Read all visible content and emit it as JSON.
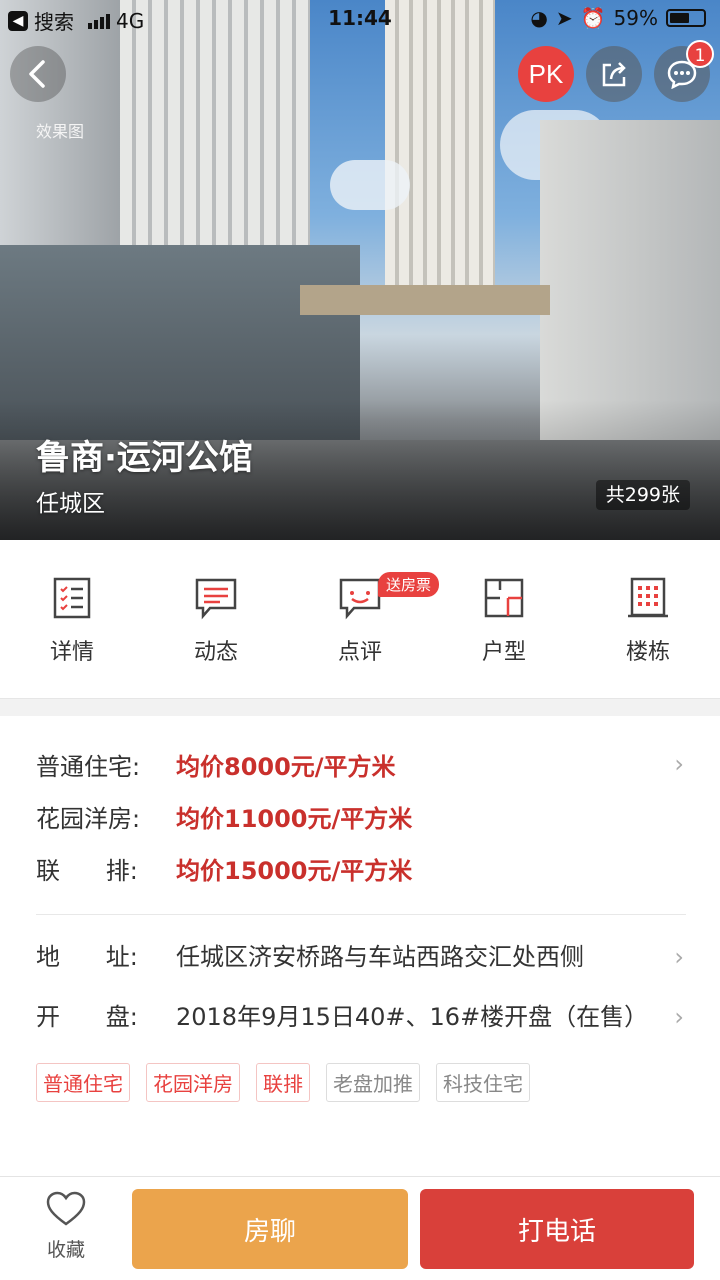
{
  "status_bar": {
    "carrier": "搜索",
    "network": "4G",
    "time": "11:44",
    "battery": "59%",
    "battery_level": 0.59
  },
  "hero": {
    "image_label": "效果图",
    "project_name": "鲁商·运河公馆",
    "district": "任城区",
    "photo_count": "共299张",
    "pk_label": "PK",
    "message_badge": "1"
  },
  "nav": [
    {
      "label": "详情",
      "icon": "details-list-icon"
    },
    {
      "label": "动态",
      "icon": "news-icon"
    },
    {
      "label": "点评",
      "icon": "comment-icon",
      "promo": "送房票"
    },
    {
      "label": "户型",
      "icon": "floorplan-icon"
    },
    {
      "label": "楼栋",
      "icon": "building-icon"
    }
  ],
  "prices": [
    {
      "type": "普通住宅:",
      "price": "均价8000元/平方米"
    },
    {
      "type": "花园洋房:",
      "price": "均价11000元/平方米"
    },
    {
      "type": "联      排:",
      "price": "均价15000元/平方米"
    }
  ],
  "address": {
    "label": "地      址:",
    "value": "任城区济安桥路与车站西路交汇处西侧"
  },
  "opening": {
    "label": "开      盘:",
    "value": "2018年9月15日40#、16#楼开盘（在售）"
  },
  "tags": [
    {
      "text": "普通住宅",
      "style": "red"
    },
    {
      "text": "花园洋房",
      "style": "red"
    },
    {
      "text": "联排",
      "style": "red"
    },
    {
      "text": "老盘加推",
      "style": "gray"
    },
    {
      "text": "科技住宅",
      "style": "gray"
    }
  ],
  "bottom_bar": {
    "favorite_label": "收藏",
    "chat_label": "房聊",
    "call_label": "打电话"
  },
  "colors": {
    "accent_red": "#e8413f",
    "price_red": "#c9302c",
    "chat_orange": "#eba44c",
    "call_red": "#d9403a"
  }
}
